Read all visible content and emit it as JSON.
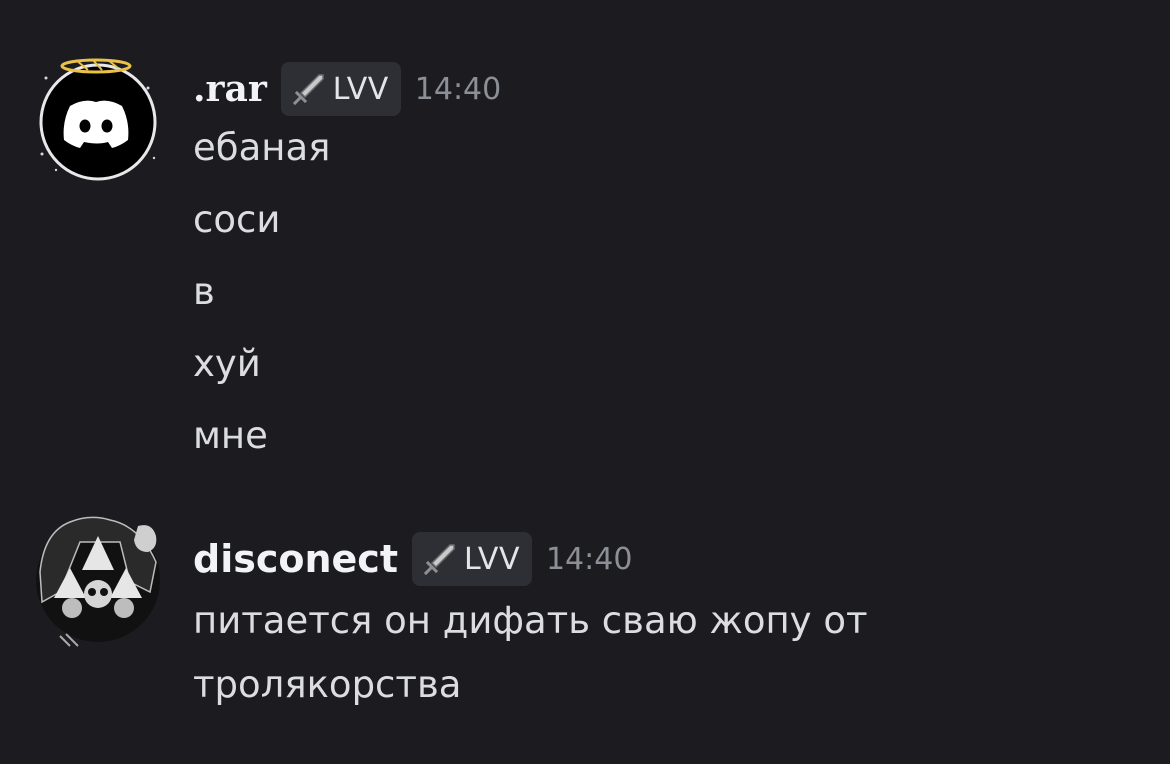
{
  "messages": [
    {
      "username": ".rar",
      "tag": "LVV",
      "timestamp": "14:40",
      "lines": [
        "ебаная",
        "соси",
        "в",
        "хуй",
        "мне"
      ]
    },
    {
      "username": "disconect",
      "tag": "LVV",
      "timestamp": "14:40",
      "lines": [
        "питается он дифать сваю жопу от",
        "тролякорства"
      ]
    }
  ],
  "colors": {
    "background": "#1b1b20",
    "username": "#f2f3f5",
    "message_text": "#dcdde1",
    "timestamp": "#8d8f97",
    "tag_bg": "#2e2f35",
    "halo": "#e9c04a"
  },
  "icons": {
    "tag_icon": "sword-icon",
    "avatar1": "discord-logo-avatar-with-halo",
    "avatar2": "skull-art-avatar"
  }
}
